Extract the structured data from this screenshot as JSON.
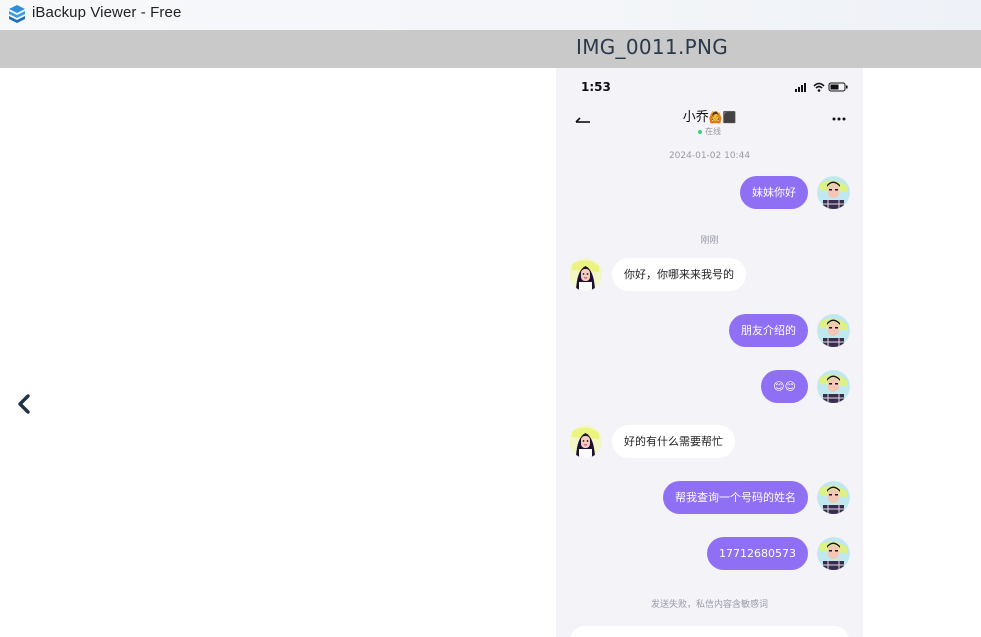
{
  "window": {
    "title": "iBackup Viewer - Free",
    "icon": "ibackup-logo-icon"
  },
  "viewer": {
    "filename": "IMG_0011.PNG",
    "prev_icon": "chevron-left-icon"
  },
  "phone": {
    "status_time": "1:53",
    "status_icons": [
      "signal-icon",
      "wifi-icon",
      "battery-icon"
    ],
    "header": {
      "contact_name": "小乔",
      "name_emoji": "🙆⬛",
      "status": "在线"
    },
    "messages": [
      {
        "type": "time",
        "text": "2024-01-02 10:44"
      },
      {
        "type": "me",
        "text": "妹妹你好"
      },
      {
        "type": "time",
        "text": "刚刚"
      },
      {
        "type": "them",
        "text": "你好，你哪来来我号的"
      },
      {
        "type": "me",
        "text": "朋友介绍的"
      },
      {
        "type": "me",
        "text": "😊😊"
      },
      {
        "type": "them",
        "text": "好的有什么需要帮忙"
      },
      {
        "type": "me",
        "text": "帮我查询一个号码的姓名"
      },
      {
        "type": "me",
        "text": "17712680573"
      },
      {
        "type": "notice",
        "text": "发送失败，私信内容含敏感词"
      }
    ]
  },
  "colors": {
    "my_bubble": "#8f6ff3",
    "their_bubble": "#ffffff",
    "chat_bg": "#f3f3f8",
    "file_bar": "#c9c9c9",
    "online_dot": "#3ccf7a"
  }
}
